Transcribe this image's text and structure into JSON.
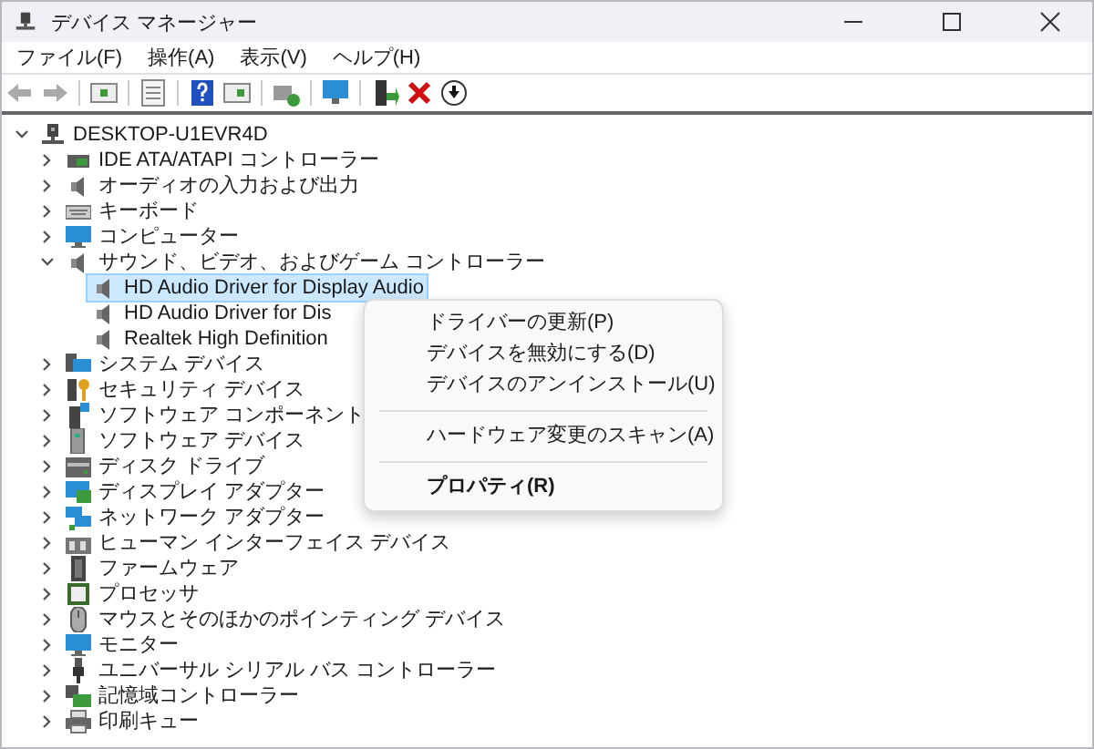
{
  "window": {
    "title": "デバイス マネージャー"
  },
  "menu_bar": [
    {
      "label": "ファイル(F)"
    },
    {
      "label": "操作(A)"
    },
    {
      "label": "表示(V)"
    },
    {
      "label": "ヘルプ(H)"
    }
  ],
  "tree": {
    "label": "DESKTOP-U1EVR4D",
    "expanded": true,
    "selected": false,
    "children": [
      {
        "label": "IDE ATA/ATAPI コントローラー",
        "expanded": false,
        "selected": false
      },
      {
        "label": "オーディオの入力および出力",
        "expanded": false,
        "selected": false
      },
      {
        "label": "キーボード",
        "expanded": false,
        "selected": false
      },
      {
        "label": "コンピューター",
        "expanded": false,
        "selected": false
      },
      {
        "label": "サウンド、ビデオ、およびゲーム コントローラー",
        "expanded": true,
        "selected": false,
        "children": [
          {
            "label": "HD Audio Driver for Display Audio",
            "selected": true
          },
          {
            "label": "HD Audio Driver for Dis",
            "selected": false
          },
          {
            "label": "Realtek High Definition",
            "selected": false
          }
        ]
      },
      {
        "label": "システム デバイス",
        "expanded": false,
        "selected": false
      },
      {
        "label": "セキュリティ デバイス",
        "expanded": false,
        "selected": false
      },
      {
        "label": "ソフトウェア コンポーネント",
        "expanded": false,
        "selected": false
      },
      {
        "label": "ソフトウェア デバイス",
        "expanded": false,
        "selected": false
      },
      {
        "label": "ディスク ドライブ",
        "expanded": false,
        "selected": false
      },
      {
        "label": "ディスプレイ アダプター",
        "expanded": false,
        "selected": false
      },
      {
        "label": "ネットワーク アダプター",
        "expanded": false,
        "selected": false
      },
      {
        "label": "ヒューマン インターフェイス デバイス",
        "expanded": false,
        "selected": false
      },
      {
        "label": "ファームウェア",
        "expanded": false,
        "selected": false
      },
      {
        "label": "プロセッサ",
        "expanded": false,
        "selected": false
      },
      {
        "label": "マウスとそのほかのポインティング デバイス",
        "expanded": false,
        "selected": false
      },
      {
        "label": "モニター",
        "expanded": false,
        "selected": false
      },
      {
        "label": "ユニバーサル シリアル バス コントローラー",
        "expanded": false,
        "selected": false
      },
      {
        "label": "記憶域コントローラー",
        "expanded": false,
        "selected": false
      },
      {
        "label": "印刷キュー",
        "expanded": false,
        "selected": false
      }
    ]
  },
  "context_menu": [
    {
      "kind": "item",
      "label": "ドライバーの更新(P)",
      "default": false
    },
    {
      "kind": "item",
      "label": "デバイスを無効にする(D)",
      "default": false
    },
    {
      "kind": "item",
      "label": "デバイスのアンインストール(U)",
      "default": false
    },
    {
      "kind": "separator"
    },
    {
      "kind": "item",
      "label": "ハードウェア変更のスキャン(A)",
      "default": false
    },
    {
      "kind": "separator"
    },
    {
      "kind": "item",
      "label": "プロパティ(R)",
      "default": true
    }
  ]
}
